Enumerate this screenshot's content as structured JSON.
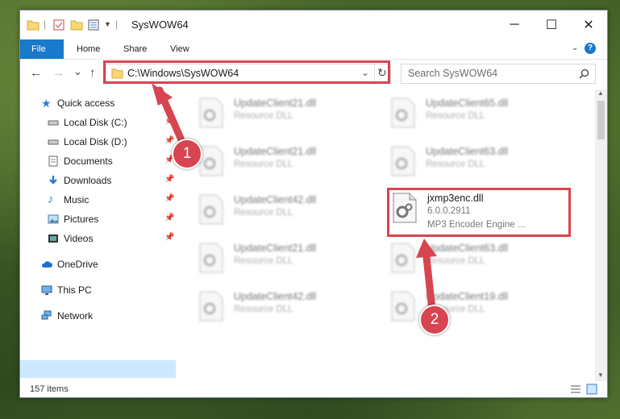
{
  "window": {
    "title": "SysWOW64",
    "controls": {
      "minimize": "─",
      "maximize": "☐",
      "close": "✕"
    }
  },
  "ribbon": {
    "tabs": [
      "File",
      "Home",
      "Share",
      "View"
    ]
  },
  "nav": {
    "back": "←",
    "forward": "→",
    "recent": "⌄",
    "up": "↑",
    "address": "C:\\Windows\\SysWOW64",
    "search_placeholder": "Search SysWOW64"
  },
  "sidebar": {
    "items": [
      {
        "label": "Quick access",
        "icon": "star-icon"
      },
      {
        "label": "Local Disk (C:)",
        "icon": "drive-icon"
      },
      {
        "label": "Local Disk (D:)",
        "icon": "drive-icon"
      },
      {
        "label": "Documents",
        "icon": "documents-icon"
      },
      {
        "label": "Downloads",
        "icon": "download-icon"
      },
      {
        "label": "Music",
        "icon": "music-icon"
      },
      {
        "label": "Pictures",
        "icon": "pictures-icon"
      },
      {
        "label": "Videos",
        "icon": "videos-icon"
      },
      {
        "label": "OneDrive",
        "icon": "cloud-icon"
      },
      {
        "label": "This PC",
        "icon": "computer-icon"
      },
      {
        "label": "Network",
        "icon": "network-icon"
      }
    ]
  },
  "files": [
    {
      "name": "UpdateClient21.dll",
      "type": "Resource DLL"
    },
    {
      "name": "UpdateClient65.dll",
      "type": "Resource DLL"
    },
    {
      "name": "UpdateClient21.dll",
      "type": "Resource DLL"
    },
    {
      "name": "UpdateClient63.dll",
      "type": "Resource DLL"
    },
    {
      "name": "UpdateClient42.dll",
      "type": "Resource DLL"
    },
    {
      "name": "UpdateClient21.dll",
      "type": "Resource DLL"
    },
    {
      "name": "UpdateClient63.dll",
      "type": "Resource DLL"
    },
    {
      "name": "UpdateClient42.dll",
      "type": "Resource DLL"
    },
    {
      "name": "UpdateClient19.dll",
      "type": "Resource DLL"
    }
  ],
  "highlighted_file": {
    "name": "jxmp3enc.dll",
    "version": "6.0.0.2911",
    "description": "MP3 Encoder Engine ..."
  },
  "status": {
    "items_count": "157 items"
  },
  "annotations": {
    "step1": "1",
    "step2": "2",
    "color": "#d64550"
  }
}
